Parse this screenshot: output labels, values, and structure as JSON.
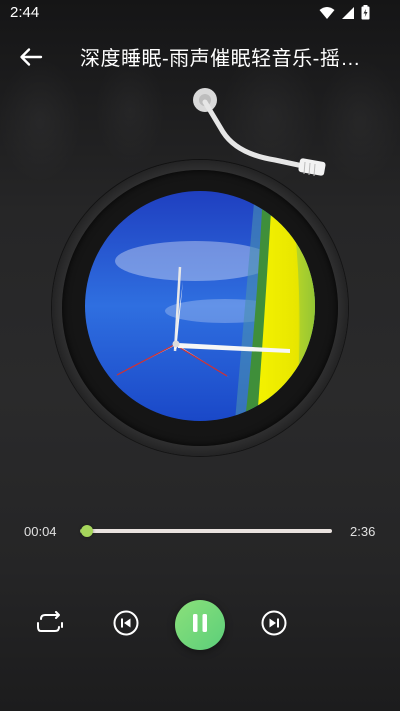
{
  "status_bar": {
    "time": "2:44"
  },
  "header": {
    "title": "深度睡眠-雨声催眠轻音乐-摇篮曲"
  },
  "player": {
    "current_time": "00:04",
    "total_time": "2:36",
    "progress_fraction": 0.026,
    "is_playing": true
  },
  "icons": {
    "back": "back-arrow-icon",
    "repeat": "repeat-icon",
    "prev": "skip-previous-icon",
    "play_pause": "pause-icon",
    "next": "skip-next-icon",
    "wifi": "wifi-icon",
    "signal": "cell-signal-icon",
    "battery": "battery-icon"
  },
  "colors": {
    "accent_green": "#6fd67a",
    "progress_fill": "#a8d46a",
    "track": "#e9e2df",
    "background": "#262627"
  }
}
